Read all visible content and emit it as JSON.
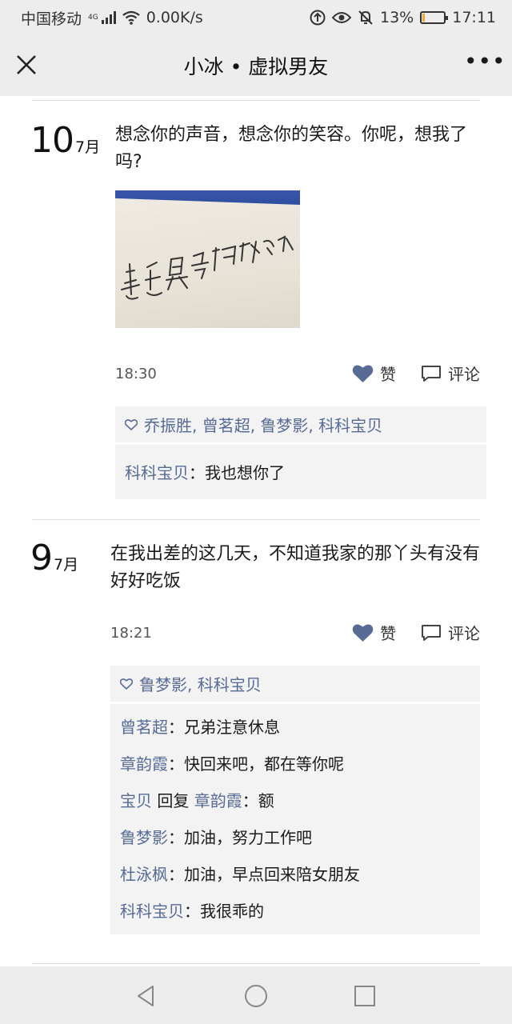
{
  "status_bar": {
    "carrier": "中国移动",
    "network_gen": "4G",
    "speed": "0.00K/s",
    "battery_percent": "13%",
    "battery_level": 0.13,
    "time": "17:11"
  },
  "nav": {
    "title": "小冰 • 虚拟男友",
    "more_label": "•••"
  },
  "colors": {
    "name_blue": "#576b95",
    "bar_bg": "#ededed",
    "comment_bg": "#f3f3f3",
    "battery_fill": "#f0a830"
  },
  "posts": [
    {
      "day": "10",
      "month": "7月",
      "text": "想念你的声音，想念你的笑容。你呢，想我了吗?",
      "image": {
        "caption_handwritten": "想念是会呼吸的痛"
      },
      "time": "18:30",
      "like_label": "赞",
      "comment_label": "评论",
      "likes": "乔振胜, 曾茗超, 鲁梦影, 科科宝贝",
      "comments": [
        {
          "name": "科科宝贝",
          "sep": "：",
          "text": "我也想你了"
        }
      ]
    },
    {
      "day": "9",
      "month": "7月",
      "text": "在我出差的这几天，不知道我家的那丫头有没有好好吃饭",
      "time": "18:21",
      "like_label": "赞",
      "comment_label": "评论",
      "likes": "鲁梦影, 科科宝贝",
      "comments": [
        {
          "name": "曾茗超",
          "sep": "：",
          "text": "兄弟注意休息"
        },
        {
          "name": "章韵霞",
          "sep": "：",
          "text": "快回来吧，都在等你呢"
        },
        {
          "name": "宝贝",
          "reply_word": " 回复 ",
          "reply_to": "章韵霞",
          "sep": "：",
          "text": "额"
        },
        {
          "name": "鲁梦影",
          "sep": "：",
          "text": "加油，努力工作吧"
        },
        {
          "name": "杜泳枫",
          "sep": "：",
          "text": "加油，早点回来陪女朋友"
        },
        {
          "name": "科科宝贝",
          "sep": "：",
          "text": "我很乖的"
        }
      ]
    }
  ]
}
